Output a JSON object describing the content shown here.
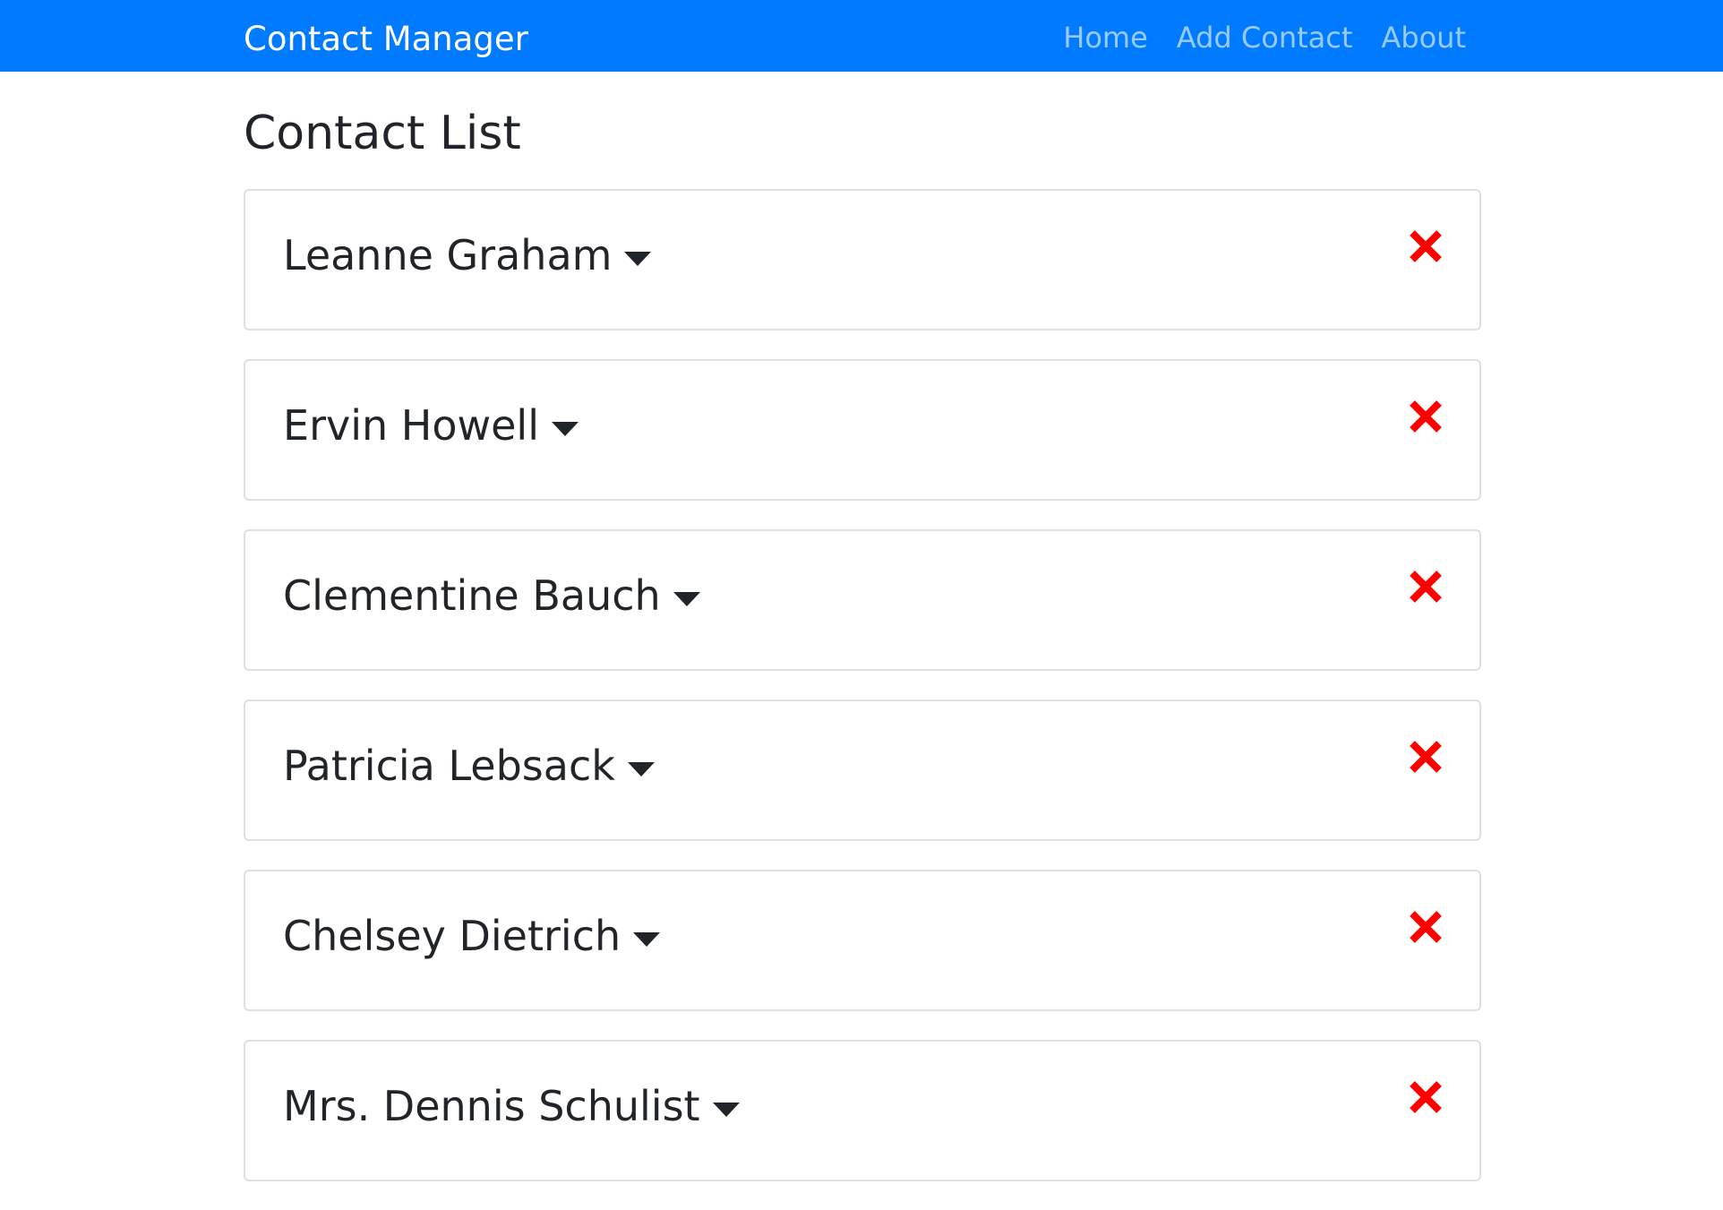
{
  "navbar": {
    "brand": "Contact Manager",
    "links": [
      {
        "label": "Home"
      },
      {
        "label": "Add Contact"
      },
      {
        "label": "About"
      }
    ],
    "background_color": "#007bff"
  },
  "main": {
    "title": "Contact List",
    "contacts": [
      {
        "name": "Leanne Graham"
      },
      {
        "name": "Ervin Howell"
      },
      {
        "name": "Clementine Bauch"
      },
      {
        "name": "Patricia Lebsack"
      },
      {
        "name": "Chelsey Dietrich"
      },
      {
        "name": "Mrs. Dennis Schulist"
      }
    ],
    "expand_icon": "caret-down-icon",
    "delete_icon": "close-icon",
    "delete_color": "#ff0000"
  }
}
